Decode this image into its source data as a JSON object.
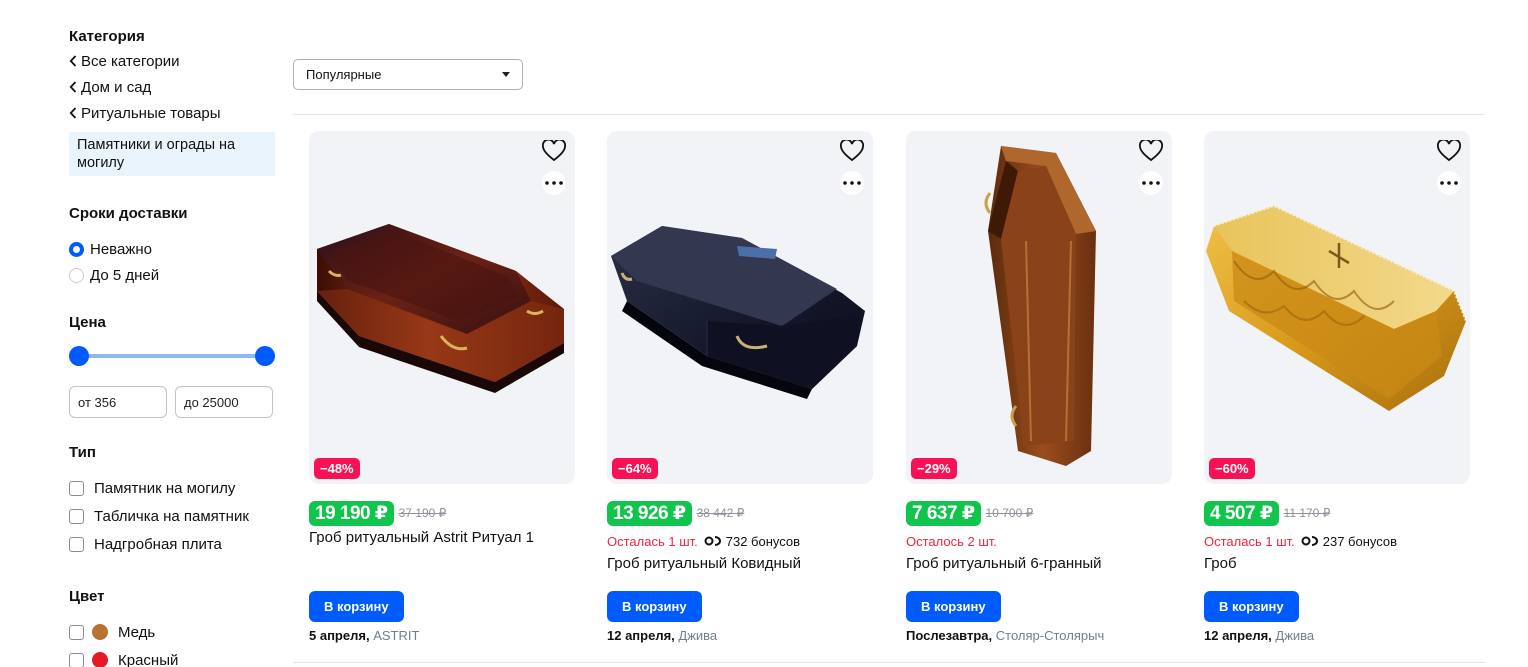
{
  "sidebar": {
    "category": {
      "title": "Категория",
      "links": [
        "Все категории",
        "Дом и сад",
        "Ритуальные товары"
      ],
      "active": "Памятники и ограды на могилу"
    },
    "delivery": {
      "title": "Сроки доставки",
      "options": [
        {
          "label": "Неважно",
          "selected": true
        },
        {
          "label": "До 5 дней",
          "selected": false
        }
      ]
    },
    "price": {
      "title": "Цена",
      "from_value": "от 356",
      "to_value": "до 25000",
      "range": [
        356,
        25000
      ]
    },
    "type": {
      "title": "Тип",
      "options": [
        "Памятник на могилу",
        "Табличка на памятник",
        "Надгробная плита"
      ]
    },
    "color": {
      "title": "Цвет",
      "options": [
        {
          "label": "Медь",
          "color": "#b87333"
        },
        {
          "label": "Красный",
          "color": "#e31b23"
        }
      ]
    }
  },
  "sort": {
    "selected": "Популярные"
  },
  "colors": {
    "accent": "#005bff",
    "price_bg": "#10c44c",
    "discount_bg": "#f91155",
    "stock_text": "#f1263b"
  },
  "products": [
    {
      "discount": "−48%",
      "price": "19 190 ₽",
      "old_price": "37 190 ₽",
      "stock": "",
      "bonus": "",
      "title": "Гроб ритуальный Astrit Ритуал 1",
      "buy_label": "В корзину",
      "delivery_date": "5 апреля,",
      "seller": "ASTRIT",
      "image": "dark-red-coffin"
    },
    {
      "discount": "−64%",
      "price": "13 926 ₽",
      "old_price": "38 442 ₽",
      "stock": "Осталась 1 шт.",
      "bonus": "732 бонусов",
      "title": "Гроб ритуальный Ковидный",
      "buy_label": "В корзину",
      "delivery_date": "12 апреля,",
      "seller": "Джива",
      "image": "navy-coffin-with-window"
    },
    {
      "discount": "−29%",
      "price": "7 637 ₽",
      "old_price": "10 700 ₽",
      "stock": "Осталось 2 шт.",
      "bonus": "",
      "title": "Гроб ритуальный 6-гранный",
      "buy_label": "В корзину",
      "delivery_date": "Послезавтра,",
      "seller": "Столяр-Столярыч",
      "image": "brown-hexagonal-coffin"
    },
    {
      "discount": "−60%",
      "price": "4 507 ₽",
      "old_price": "11 170 ₽",
      "stock": "Осталась 1 шт.",
      "bonus": "237 бонусов",
      "title": "Гроб",
      "buy_label": "В корзину",
      "delivery_date": "12 апреля,",
      "seller": "Джива",
      "image": "gold-fabric-coffin"
    }
  ]
}
